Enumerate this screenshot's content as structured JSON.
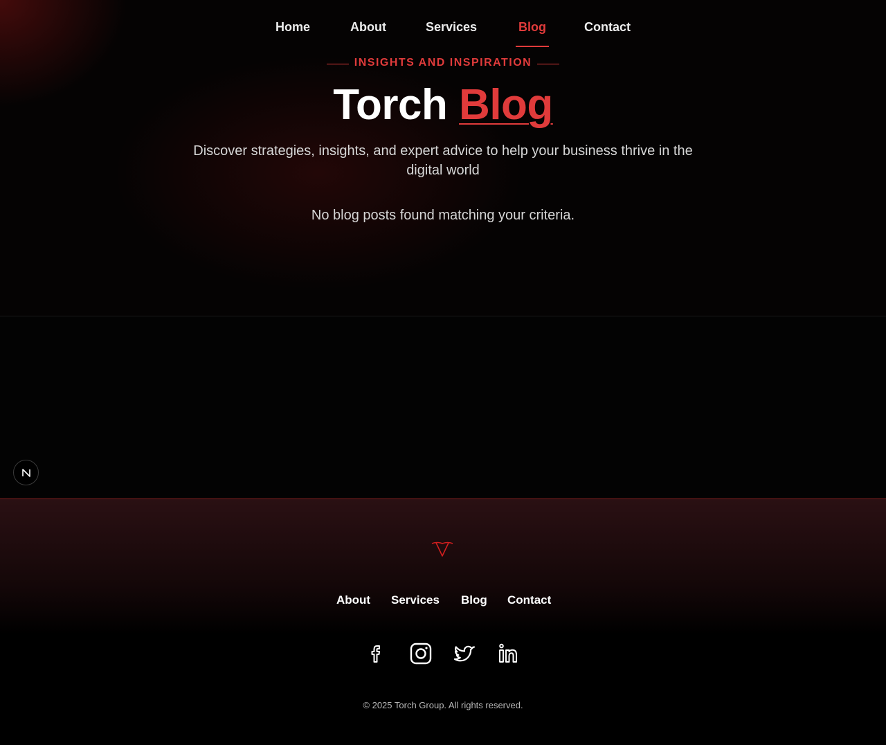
{
  "nav": {
    "items": [
      {
        "label": "Home"
      },
      {
        "label": "About"
      },
      {
        "label": "Services"
      },
      {
        "label": "Blog",
        "active": true
      },
      {
        "label": "Contact"
      }
    ]
  },
  "hero": {
    "eyebrow": "INSIGHTS AND INSPIRATION",
    "title_main": "Torch",
    "title_accent": "Blog",
    "subtitle": "Discover strategies, insights, and expert advice to help your business thrive in the digital world",
    "empty_message": "No blog posts found matching your criteria."
  },
  "dev_badge": {
    "label": "N"
  },
  "footer": {
    "links": [
      {
        "label": "About"
      },
      {
        "label": "Services"
      },
      {
        "label": "Blog"
      },
      {
        "label": "Contact"
      }
    ],
    "socials": [
      {
        "icon": "facebook-icon"
      },
      {
        "icon": "instagram-icon"
      },
      {
        "icon": "twitter-icon"
      },
      {
        "icon": "linkedin-icon"
      }
    ],
    "copyright": "© 2025 Torch Group. All rights reserved."
  },
  "colors": {
    "accent": "#e03b3b",
    "background": "#030303",
    "text": "#ffffff",
    "muted_text": "#d6d6d6"
  }
}
